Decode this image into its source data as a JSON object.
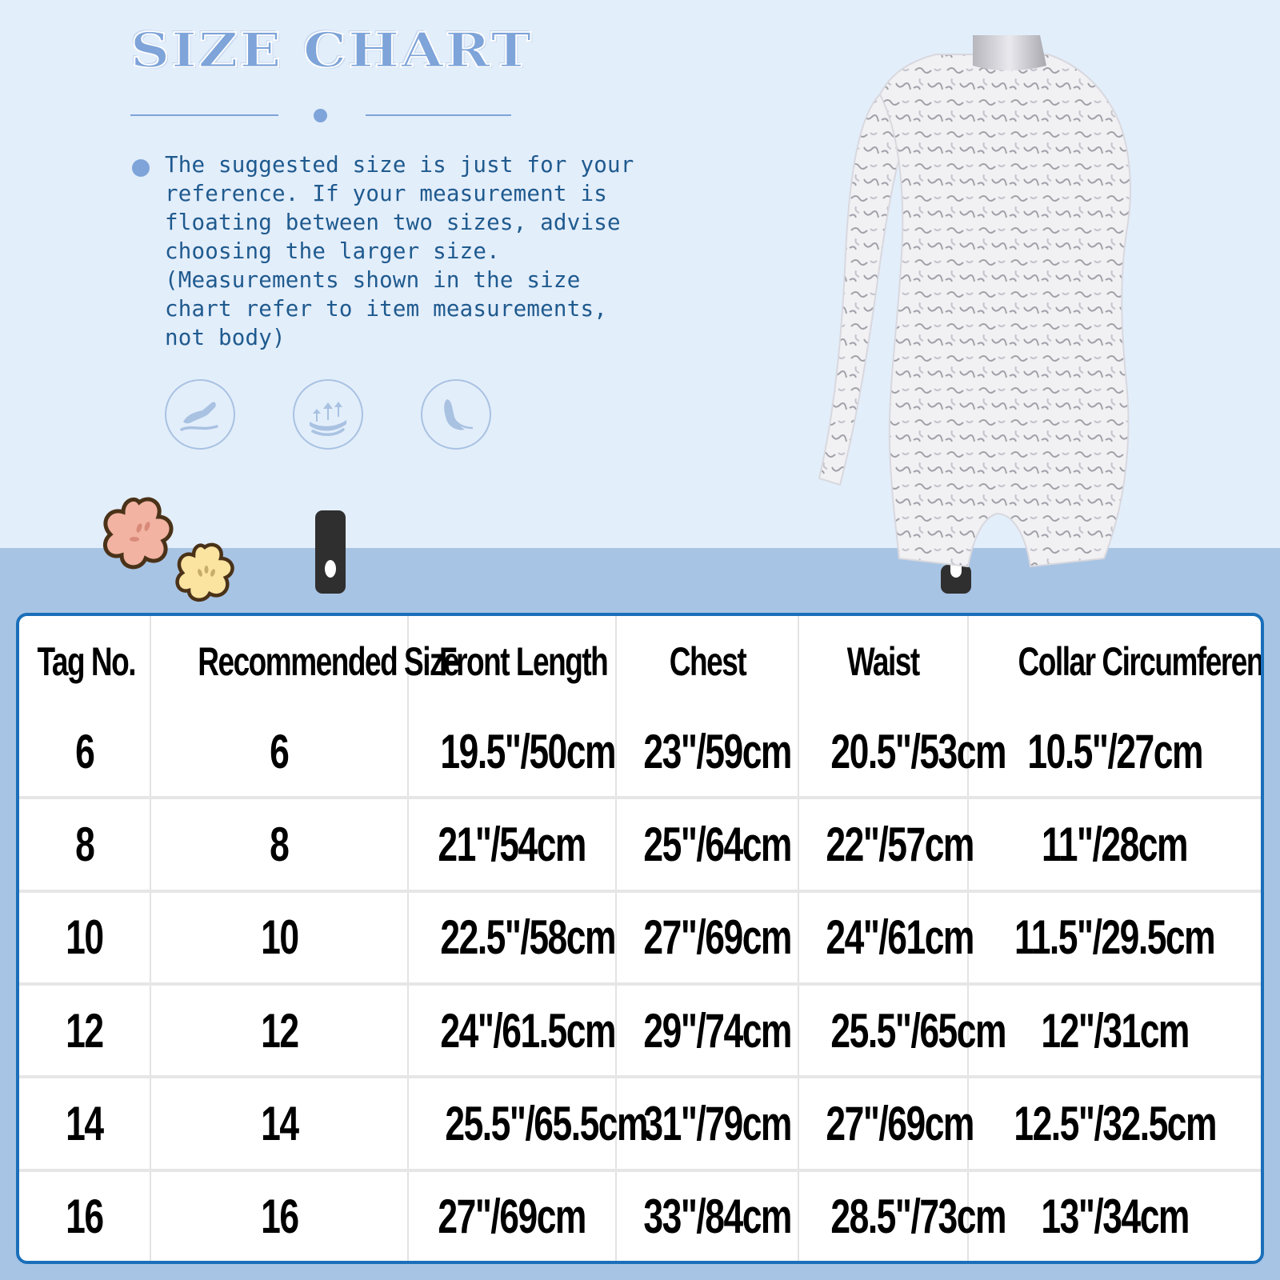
{
  "header": {
    "title": "SIZE CHART"
  },
  "note": {
    "text": "The suggested size is just for your\nreference. If your measurement is\nfloating between two sizes, advise\n choosing the larger size.\n(Measurements shown in the size\nchart refer to item measurements,\nnot body)"
  },
  "feature_icons": [
    {
      "name": "soft-touch-hand-icon"
    },
    {
      "name": "stretch-arrows-icon"
    },
    {
      "name": "lightweight-feather-icon"
    }
  ],
  "product": {
    "image_description": "Silver sequin long-sleeve one-shoulder leotard on mannequin form"
  },
  "colors": {
    "accent": "#7ea4d9",
    "note_text": "#1f5a8e",
    "table_border": "#1a6fb9",
    "page_bg": "#e3eefb",
    "band_bg": "#a8c4e4"
  },
  "table": {
    "columns": [
      "Tag No.",
      "Recommended Size",
      "Front Length",
      "Chest",
      "Waist",
      "Collar Circumference"
    ],
    "rows": [
      [
        "6",
        "6",
        "19.5\"/50cm",
        "23\"/59cm",
        "20.5\"/53cm",
        "10.5\"/27cm"
      ],
      [
        "8",
        "8",
        "21\"/54cm",
        "25\"/64cm",
        "22\"/57cm",
        "11\"/28cm"
      ],
      [
        "10",
        "10",
        "22.5\"/58cm",
        "27\"/69cm",
        "24\"/61cm",
        "11.5\"/29.5cm"
      ],
      [
        "12",
        "12",
        "24\"/61.5cm",
        "29\"/74cm",
        "25.5\"/65cm",
        "12\"/31cm"
      ],
      [
        "14",
        "14",
        "25.5\"/65.5cm",
        "31\"/79cm",
        "27\"/69cm",
        "12.5\"/32.5cm"
      ],
      [
        "16",
        "16",
        "27\"/69cm",
        "33\"/84cm",
        "28.5\"/73cm",
        "13\"/34cm"
      ]
    ]
  }
}
